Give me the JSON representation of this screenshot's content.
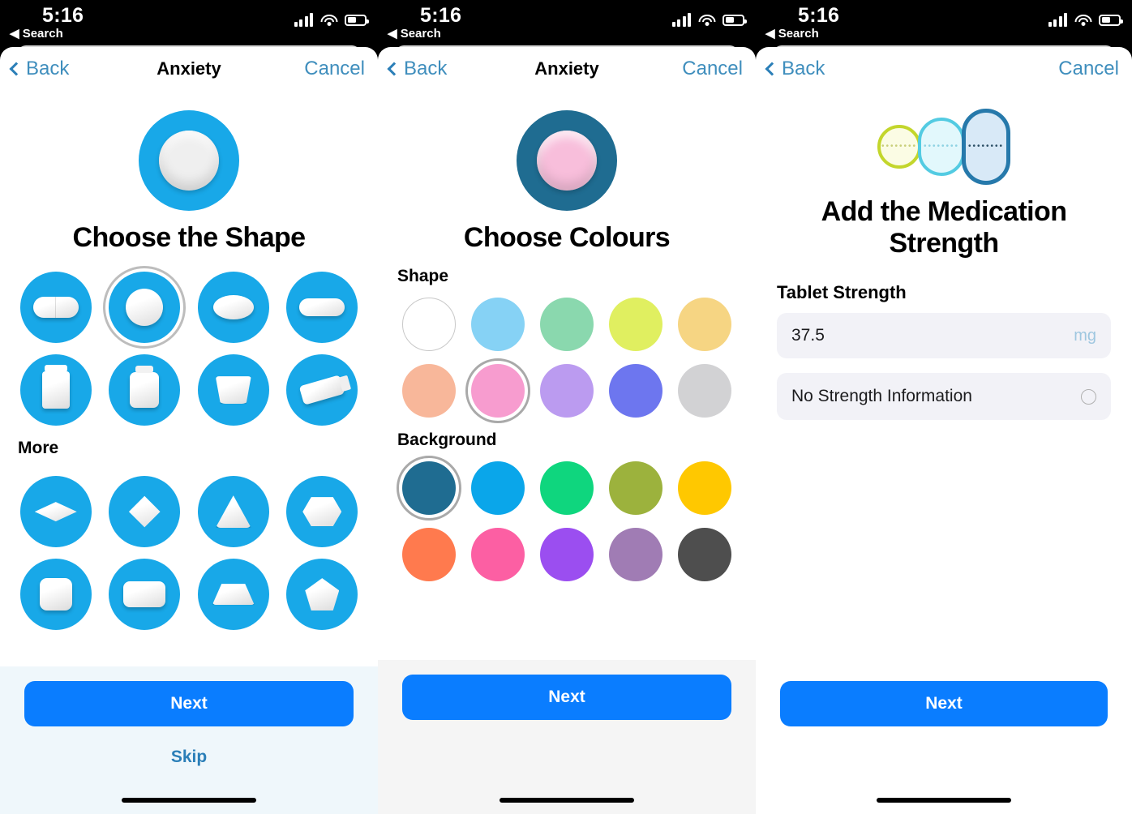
{
  "status_bar": {
    "time": "5:16",
    "back_app": "◀ Search",
    "icons": {
      "signal": "signal-bars-icon",
      "wifi": "wifi-icon",
      "battery": "battery-icon"
    }
  },
  "colors": {
    "accent_blue": "#0a7dff",
    "icon_blue": "#18a8e8",
    "link_blue": "#3f8ebd",
    "selection_ring": "#bdbdbd",
    "field_bg": "#f2f2f7"
  },
  "panels": [
    {
      "nav": {
        "back": "Back",
        "title": "Anxiety",
        "cancel": "Cancel"
      },
      "hero": {
        "bg_color": "#18a8e8",
        "pill_color": "#efefef",
        "icon": "round-pill-icon"
      },
      "title": "Choose the Shape",
      "sections": [
        {
          "label": "",
          "items": [
            {
              "name": "capsule",
              "glyph": "g-capsule",
              "selected": false
            },
            {
              "name": "round",
              "glyph": "g-round",
              "selected": true
            },
            {
              "name": "oval",
              "glyph": "g-oval",
              "selected": false
            },
            {
              "name": "caplet",
              "glyph": "g-caplet",
              "selected": false
            },
            {
              "name": "bottle",
              "glyph": "g-bottle",
              "selected": false
            },
            {
              "name": "jar",
              "glyph": "g-jar",
              "selected": false
            },
            {
              "name": "cup",
              "glyph": "g-cup",
              "selected": false
            },
            {
              "name": "tube",
              "glyph": "g-tube",
              "selected": false
            }
          ]
        },
        {
          "label": "More",
          "items": [
            {
              "name": "flat-diamond",
              "glyph": "g-diamondflat",
              "selected": false
            },
            {
              "name": "diamond",
              "glyph": "g-diamond",
              "selected": false
            },
            {
              "name": "triangle",
              "glyph": "g-triangle",
              "selected": false
            },
            {
              "name": "hexagon",
              "glyph": "g-hexagon",
              "selected": false
            },
            {
              "name": "square",
              "glyph": "g-square",
              "selected": false
            },
            {
              "name": "rectangle",
              "glyph": "g-rect",
              "selected": false
            },
            {
              "name": "trapezoid",
              "glyph": "g-trapez",
              "selected": false
            },
            {
              "name": "pentagon",
              "glyph": "g-pent",
              "selected": false
            }
          ]
        }
      ],
      "footer": {
        "next": "Next",
        "skip": "Skip"
      }
    },
    {
      "nav": {
        "back": "Back",
        "title": "Anxiety",
        "cancel": "Cancel"
      },
      "hero": {
        "bg_color": "#1f6c91",
        "pill_color": "#f8bedb",
        "icon": "round-pill-icon"
      },
      "title": "Choose Colours",
      "groups": [
        {
          "label": "Shape",
          "swatches": [
            {
              "name": "white",
              "color": "#ffffff",
              "outline": true,
              "selected": false
            },
            {
              "name": "light-blue",
              "color": "#86d2f5",
              "outline": false,
              "selected": false
            },
            {
              "name": "mint-green",
              "color": "#8ad8ae",
              "outline": false,
              "selected": false
            },
            {
              "name": "yellow-green",
              "color": "#e0ef60",
              "outline": false,
              "selected": false
            },
            {
              "name": "amber",
              "color": "#f6d583",
              "outline": false,
              "selected": false
            },
            {
              "name": "peach",
              "color": "#f8b79a",
              "outline": false,
              "selected": false
            },
            {
              "name": "pink",
              "color": "#f79ccf",
              "outline": false,
              "selected": true
            },
            {
              "name": "lavender",
              "color": "#bb9bf0",
              "outline": false,
              "selected": false
            },
            {
              "name": "periwinkle",
              "color": "#6d76ef",
              "outline": false,
              "selected": false
            },
            {
              "name": "light-grey",
              "color": "#d2d2d4",
              "outline": false,
              "selected": false
            }
          ]
        },
        {
          "label": "Background",
          "swatches": [
            {
              "name": "dark-teal",
              "color": "#1f6c91",
              "outline": false,
              "selected": true
            },
            {
              "name": "cyan-blue",
              "color": "#0aa6ea",
              "outline": false,
              "selected": false
            },
            {
              "name": "green",
              "color": "#0fd67e",
              "outline": false,
              "selected": false
            },
            {
              "name": "olive",
              "color": "#9cb23d",
              "outline": false,
              "selected": false
            },
            {
              "name": "yellow",
              "color": "#ffc800",
              "outline": false,
              "selected": false
            },
            {
              "name": "orange",
              "color": "#ff7a4e",
              "outline": false,
              "selected": false
            },
            {
              "name": "hot-pink",
              "color": "#fc5fa3",
              "outline": false,
              "selected": false
            },
            {
              "name": "purple",
              "color": "#9b4ef0",
              "outline": false,
              "selected": false
            },
            {
              "name": "mauve",
              "color": "#a07cb4",
              "outline": false,
              "selected": false
            },
            {
              "name": "dark-grey",
              "color": "#4e4e4e",
              "outline": false,
              "selected": false
            }
          ]
        }
      ],
      "footer": {
        "next": "Next"
      }
    },
    {
      "nav": {
        "back": "Back",
        "title": "",
        "cancel": "Cancel"
      },
      "hero_pills": [
        {
          "name": "small-pill",
          "border": "#c3d62c",
          "fill": "#fbfce4",
          "dots": "••••••••"
        },
        {
          "name": "medium-pill",
          "border": "#53cbe2",
          "fill": "#e2f8fc",
          "dots": "••••••••"
        },
        {
          "name": "large-pill",
          "border": "#2679ab",
          "fill": "#d8e9f7",
          "dots": "••••••••"
        }
      ],
      "title": "Add the Medication Strength",
      "form": {
        "field_label": "Tablet Strength",
        "strength_value": "37.5",
        "strength_unit": "mg",
        "no_info_label": "No Strength Information",
        "no_info_selected": false
      },
      "footer": {
        "next": "Next"
      }
    }
  ]
}
